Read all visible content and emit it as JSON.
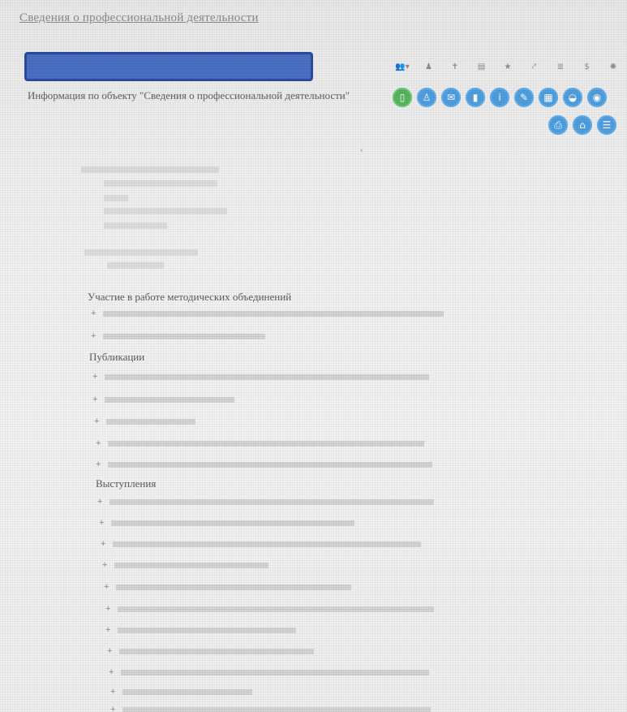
{
  "page_title": "Сведения о профессиональной деятельности",
  "object_heading": "Информация по объекту \"Сведения о профессиональной деятельности\"",
  "colors": {
    "banner": "#4a6fc4",
    "action_blue": "#4f9fe0",
    "action_green": "#57b55e"
  },
  "toolbar": [
    {
      "icon": "users-icon",
      "glyph": "👥▾"
    },
    {
      "icon": "person-icon",
      "glyph": "♟"
    },
    {
      "icon": "accessibility-icon",
      "glyph": "✝"
    },
    {
      "icon": "document-icon",
      "glyph": "▤"
    },
    {
      "icon": "star-icon",
      "glyph": "★"
    },
    {
      "icon": "link-icon",
      "glyph": "⤤"
    },
    {
      "icon": "list-icon",
      "glyph": "≣"
    },
    {
      "icon": "dollar-icon",
      "glyph": "$"
    },
    {
      "icon": "settings-icon",
      "glyph": "✺"
    }
  ],
  "action_buttons_row1": [
    {
      "icon": "phone-icon",
      "glyph": "▯",
      "color": "green"
    },
    {
      "icon": "users-icon",
      "glyph": "♙",
      "color": "blue"
    },
    {
      "icon": "mail-icon",
      "glyph": "✉",
      "color": "blue"
    },
    {
      "icon": "lock-icon",
      "glyph": "▮",
      "color": "blue"
    },
    {
      "icon": "info-icon",
      "glyph": "i",
      "color": "blue"
    },
    {
      "icon": "edit-icon",
      "glyph": "✎",
      "color": "blue"
    },
    {
      "icon": "calendar-icon",
      "glyph": "▦",
      "color": "blue"
    },
    {
      "icon": "car-icon",
      "glyph": "◒",
      "color": "blue"
    },
    {
      "icon": "camera-icon",
      "glyph": "◉",
      "color": "blue"
    }
  ],
  "action_buttons_row2": [
    {
      "icon": "print-icon",
      "glyph": "⎙",
      "color": "blue"
    },
    {
      "icon": "home-icon",
      "glyph": "⌂",
      "color": "blue"
    },
    {
      "icon": "menu-icon",
      "glyph": "☰",
      "color": "blue"
    }
  ],
  "sections": {
    "methodical": "Участие в работе методических объединений",
    "publications": "Публикации",
    "speeches": "Выступления"
  }
}
